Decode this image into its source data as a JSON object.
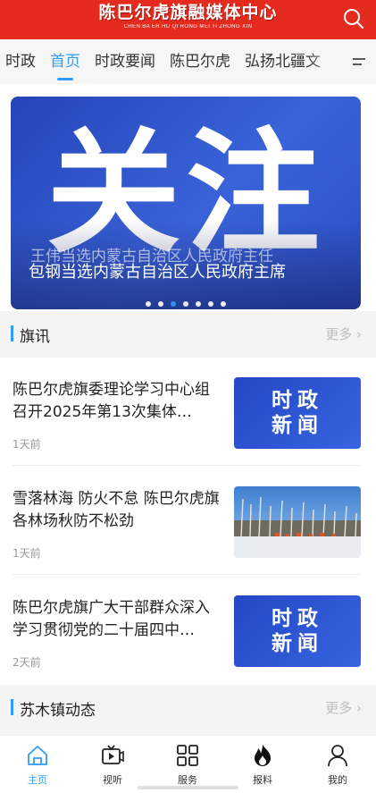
{
  "header": {
    "title": "陈巴尔虎旗融媒体中心",
    "subtitle": "CHEN BA ER HU QI RONG MEI TI ZHONG XIN",
    "search_icon": "search-icon",
    "color": "#e52b1d"
  },
  "tabs": [
    {
      "label": "时政",
      "active": false
    },
    {
      "label": "首页",
      "active": true
    },
    {
      "label": "时政要闻",
      "active": false
    },
    {
      "label": "陈巴尔虎",
      "active": false
    },
    {
      "label": "弘扬北疆文",
      "active": false
    }
  ],
  "accent_color": "#2f9cf6",
  "banner": {
    "big_text": "关注",
    "caption_back": "王伟当选内蒙古自治区人民政府主任",
    "caption": "包钢当选内蒙古自治区人民政府主席",
    "dot_count": 7,
    "active_dot": 2
  },
  "sections": {
    "qixun": {
      "title": "旗讯",
      "more": "更多"
    },
    "sumu": {
      "title": "苏木镇动态",
      "more": "更多"
    }
  },
  "news": [
    {
      "title": "陈巴尔虎旗委理论学习中心组召开2025年第13次集体…",
      "time": "1天前",
      "thumb_text_1": "时政",
      "thumb_text_2": "新闻"
    },
    {
      "title": "雪落林海 防火不怠 陈巴尔虎旗各林场秋防不松劲",
      "time": "1天前"
    },
    {
      "title": "陈巴尔虎旗广大干部群众深入学习贯彻党的二十届四中…",
      "time": "2天前",
      "thumb_text_1": "时政",
      "thumb_text_2": "新闻"
    }
  ],
  "tabbar": [
    {
      "label": "主页",
      "icon": "home-icon",
      "active": true
    },
    {
      "label": "视听",
      "icon": "video-icon",
      "active": false
    },
    {
      "label": "服务",
      "icon": "grid-icon",
      "active": false
    },
    {
      "label": "报料",
      "icon": "flame-icon",
      "active": false
    },
    {
      "label": "我的",
      "icon": "user-icon",
      "active": false
    }
  ]
}
